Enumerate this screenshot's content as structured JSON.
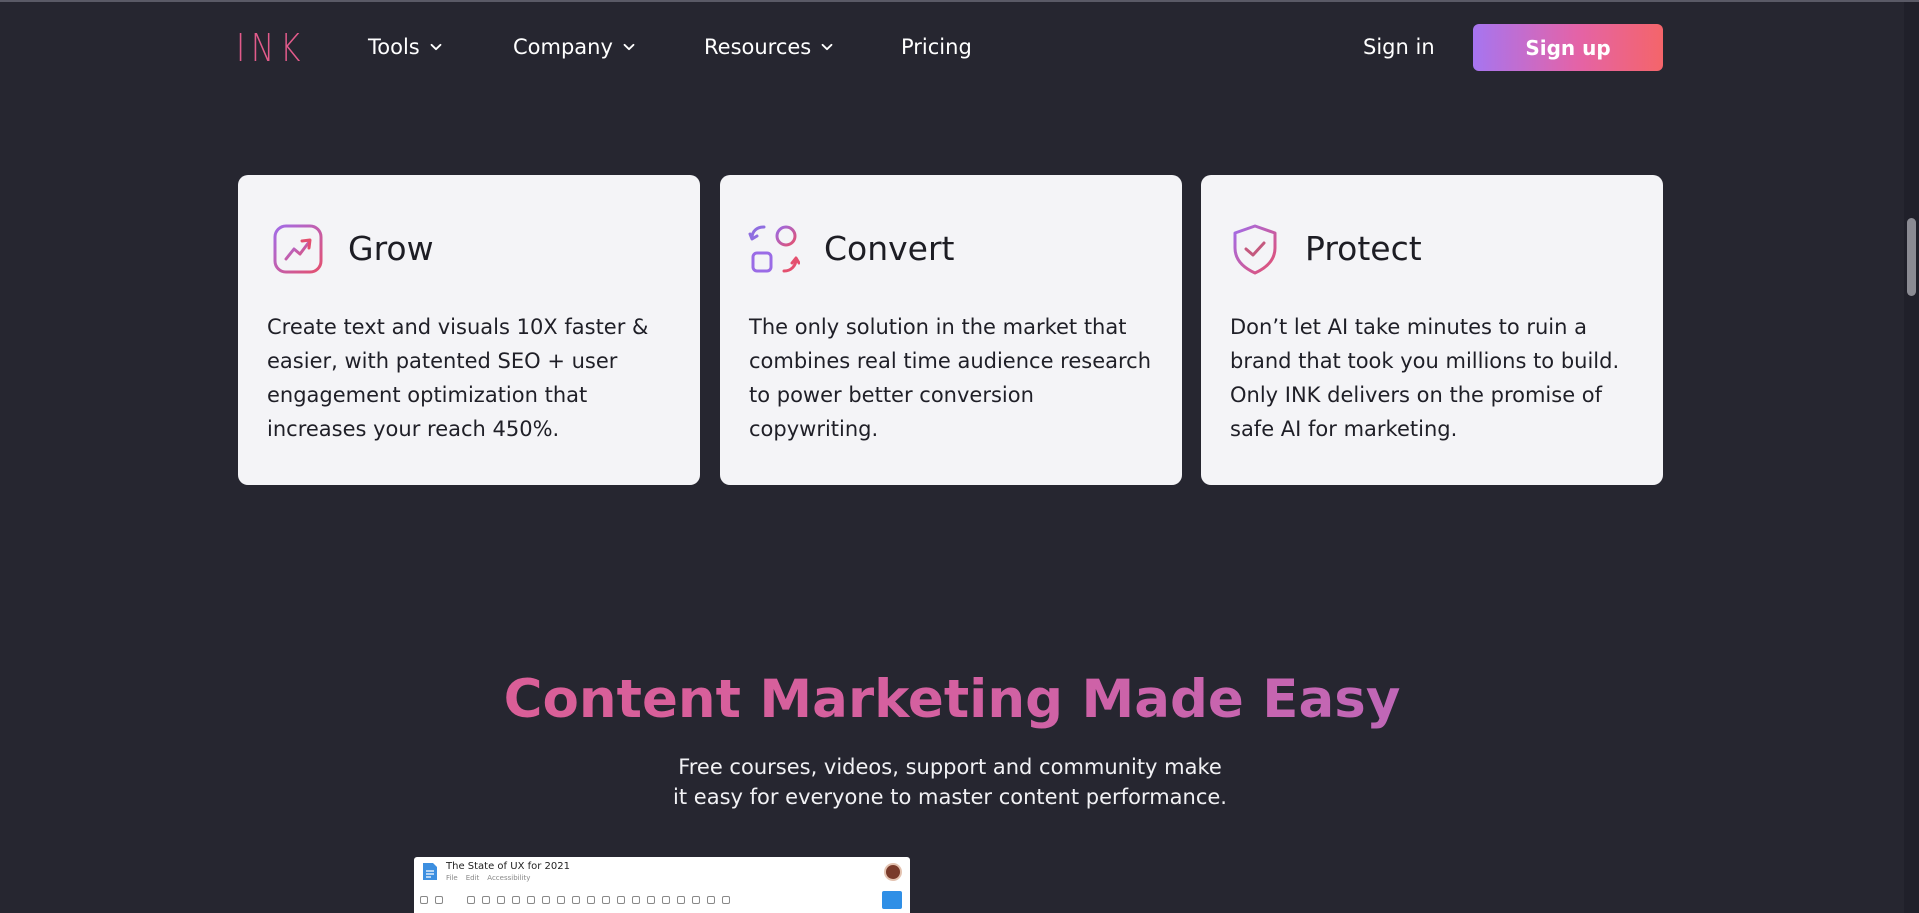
{
  "nav": {
    "logo": "INK",
    "items": [
      {
        "label": "Tools",
        "has_dropdown": true
      },
      {
        "label": "Company",
        "has_dropdown": true
      },
      {
        "label": "Resources",
        "has_dropdown": true
      },
      {
        "label": "Pricing",
        "has_dropdown": false
      }
    ],
    "sign_in": "Sign in",
    "sign_up": "Sign up"
  },
  "features": [
    {
      "title": "Grow",
      "icon": "trend-up-icon",
      "body": "Create text and visuals 10X faster & easier, with patented SEO + user engagement optimization that increases your reach 450%."
    },
    {
      "title": "Convert",
      "icon": "convert-shapes-icon",
      "body": "The only solution in the market that combines real time audience research to power better conversion copywriting."
    },
    {
      "title": "Protect",
      "icon": "shield-check-icon",
      "body": "Don’t let AI take minutes to ruin a brand that took you millions to build. Only INK delivers on the promise of safe AI for marketing."
    }
  ],
  "section": {
    "headline": "Content Marketing Made Easy",
    "subtext_line1": "Free courses, videos, support and community make",
    "subtext_line2": "it easy for everyone to master content performance."
  },
  "preview": {
    "doc_title": "The State of UX for 2021",
    "menu": [
      "File",
      "Edit",
      "Accessibility"
    ]
  },
  "colors": {
    "background": "#262630",
    "brand_pink": "#e25b8b",
    "brand_purple": "#a675f0",
    "card": "#f4f4f7"
  }
}
